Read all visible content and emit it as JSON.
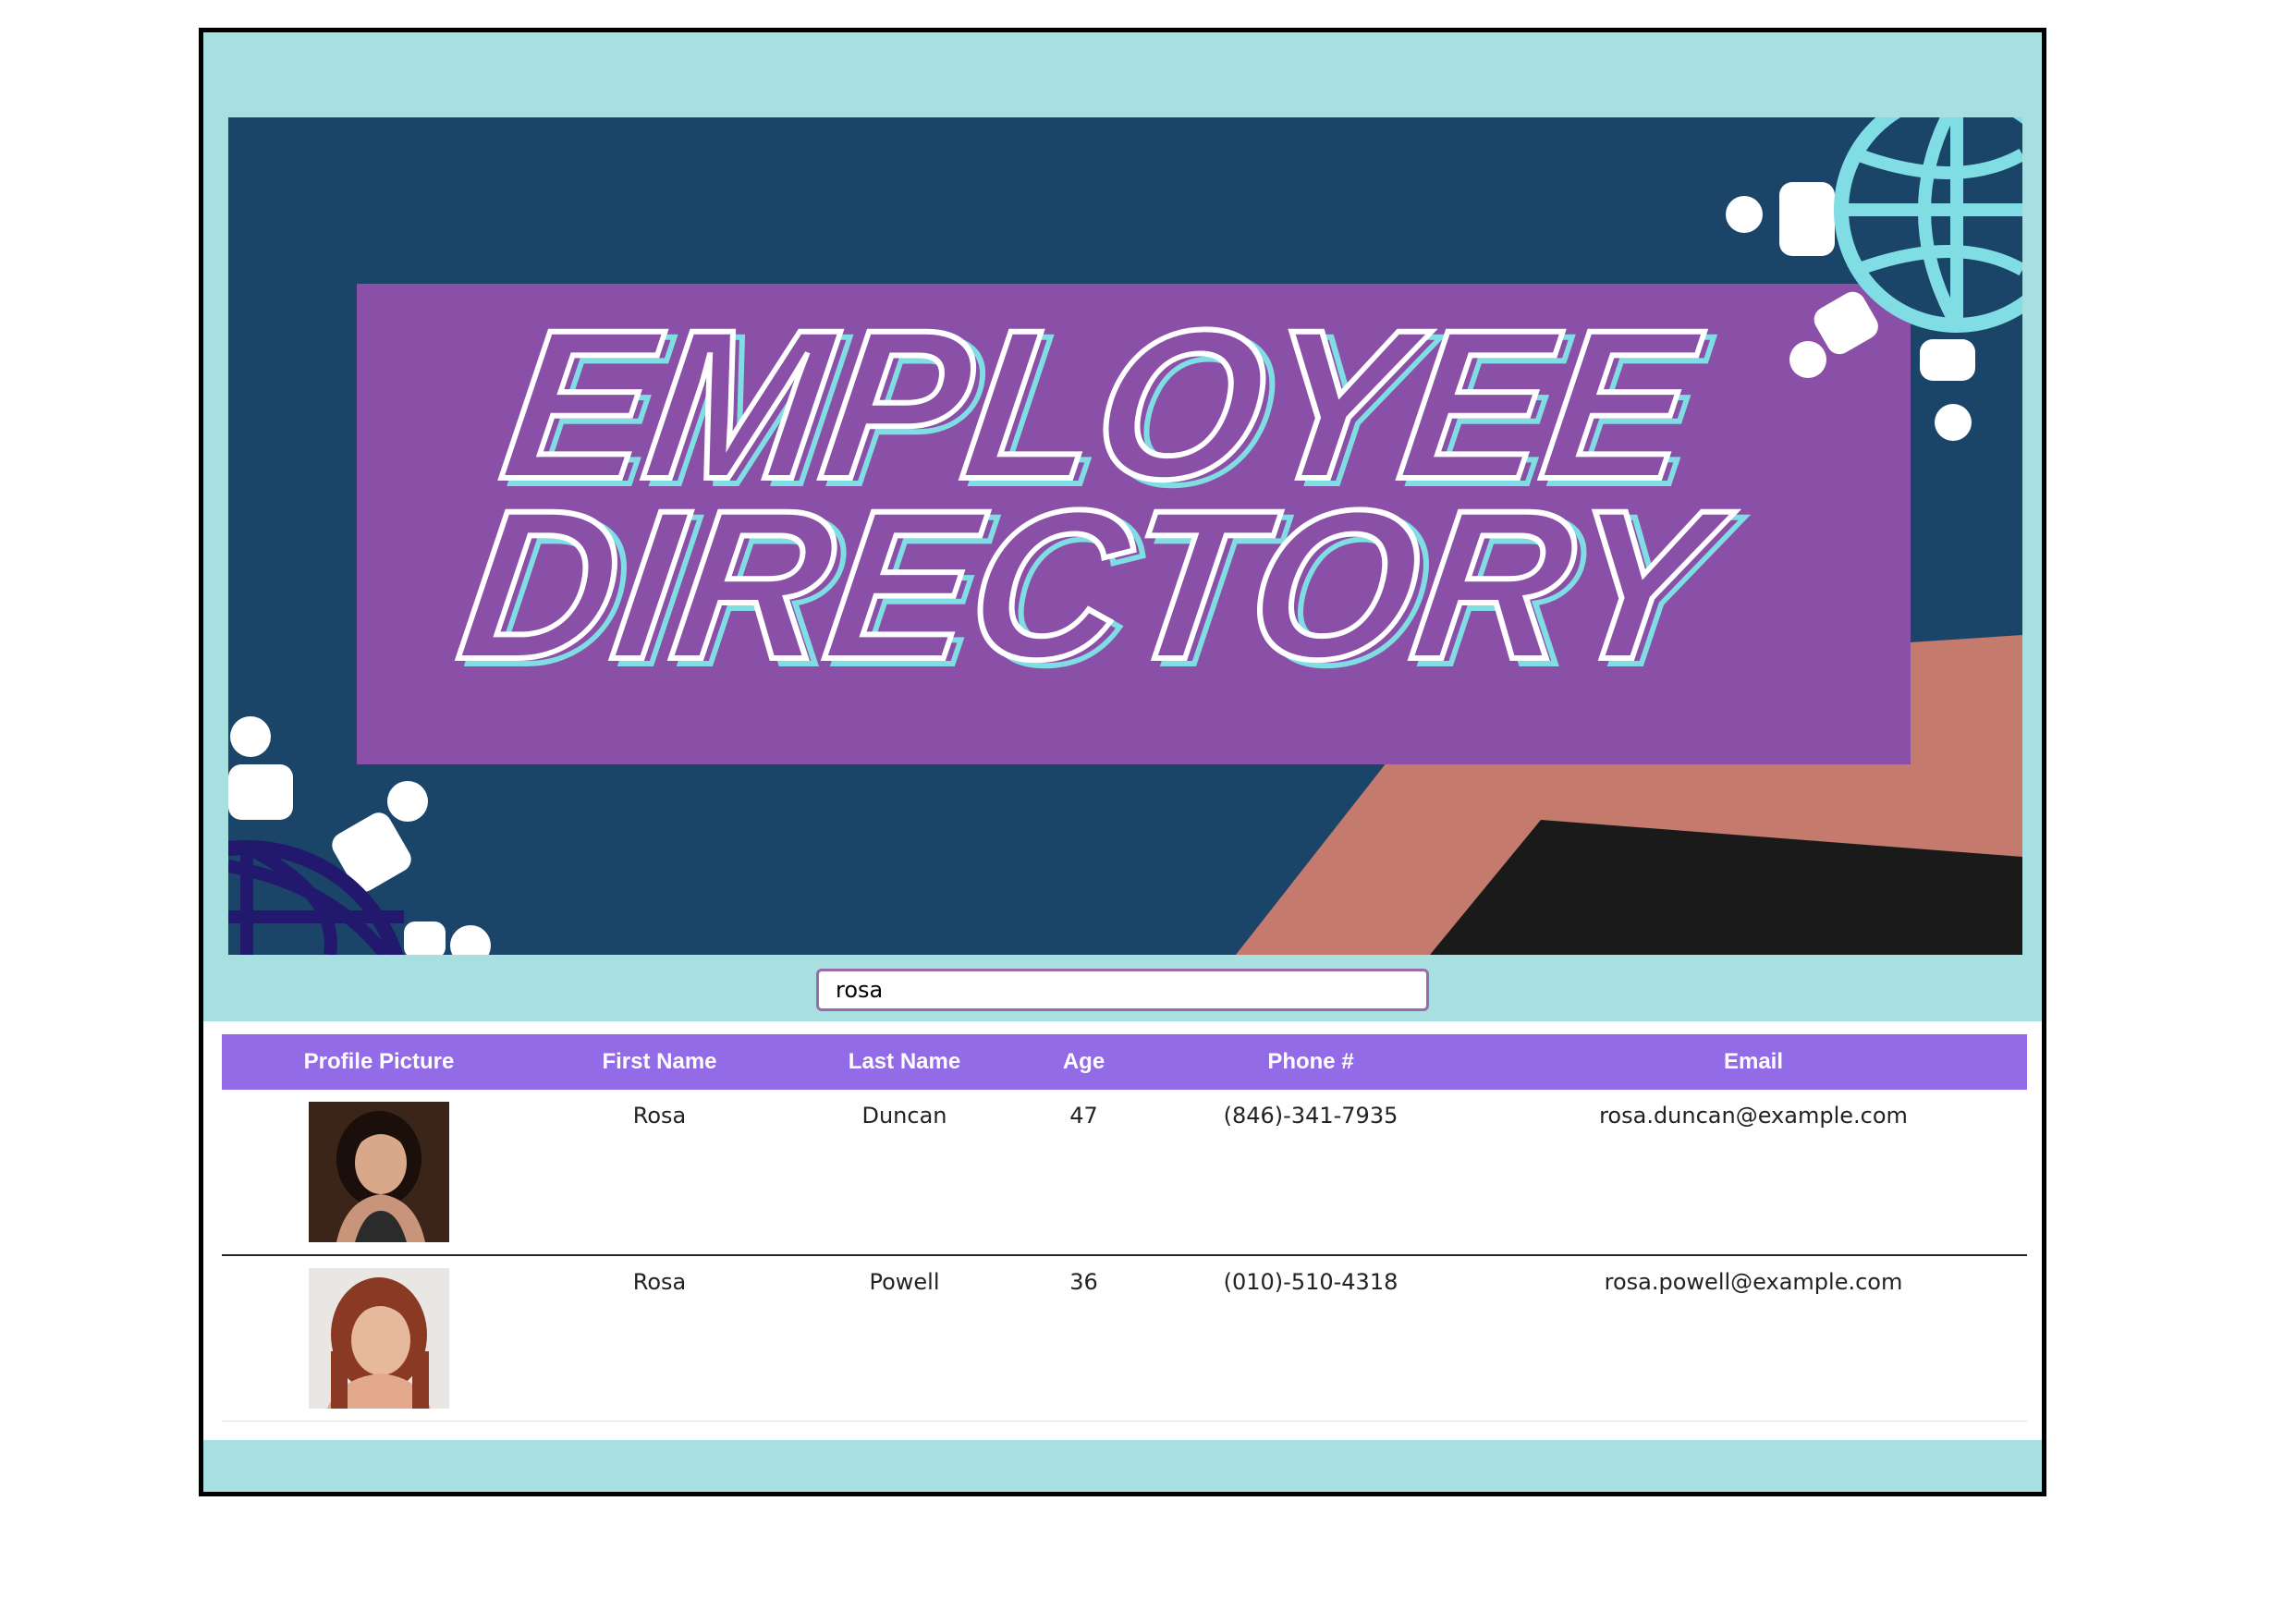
{
  "banner": {
    "title_line1": "EMPLOYEE",
    "title_line2": "DIRECTORY"
  },
  "search": {
    "value": "rosa"
  },
  "table": {
    "headers": [
      "Profile Picture",
      "First Name",
      "Last Name",
      "Age",
      "Phone #",
      "Email"
    ],
    "rows": [
      {
        "first": "Rosa",
        "last": "Duncan",
        "age": "47",
        "phone": "(846)-341-7935",
        "email": "rosa.duncan@example.com"
      },
      {
        "first": "Rosa",
        "last": "Powell",
        "age": "36",
        "phone": "(010)-510-4318",
        "email": "rosa.powell@example.com"
      }
    ]
  },
  "colors": {
    "frame_bg": "#a8e0e1",
    "banner_bg": "#1a4468",
    "title_box": "#8a4fa6",
    "header_bg": "#936be6",
    "globe": "#7fdde3"
  }
}
